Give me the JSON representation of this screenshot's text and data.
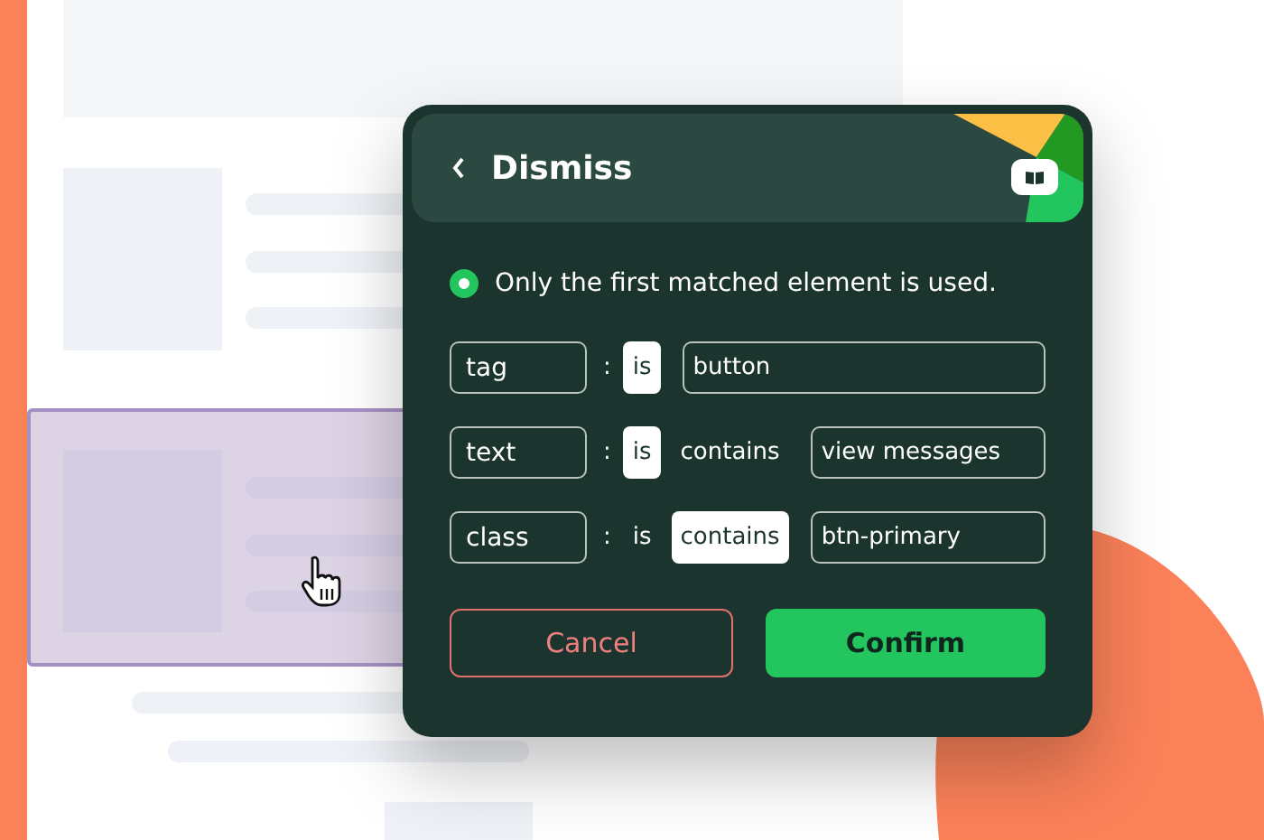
{
  "dialog": {
    "title": "Dismiss",
    "note": {
      "text": "Only the first matched element is used.",
      "selected": true
    },
    "rules": [
      {
        "key": "tag",
        "separator": ":",
        "operators": [
          {
            "label": "is",
            "selected": true
          }
        ],
        "value": "button"
      },
      {
        "key": "text",
        "separator": ":",
        "operators": [
          {
            "label": "is",
            "selected": true
          },
          {
            "label": "contains",
            "selected": false
          }
        ],
        "value": "view messages"
      },
      {
        "key": "class",
        "separator": ":",
        "operators": [
          {
            "label": "is",
            "selected": false
          },
          {
            "label": "contains",
            "selected": true
          }
        ],
        "value": "btn-primary"
      }
    ],
    "buttons": [
      {
        "label": "Cancel",
        "kind": "secondary"
      },
      {
        "label": "Confirm",
        "kind": "primary"
      }
    ]
  }
}
